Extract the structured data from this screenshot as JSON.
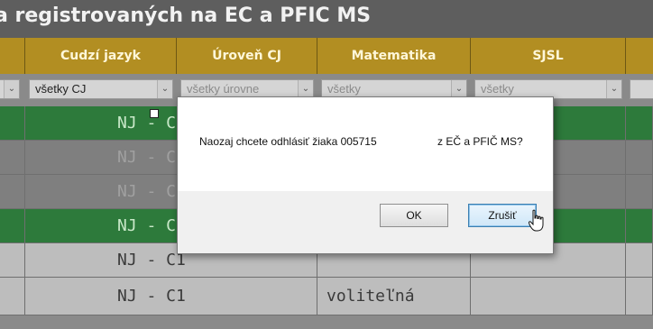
{
  "title": {
    "text": "a registrovaných na EC a PFIC MS"
  },
  "columns": [
    {
      "label": "Cudzí jazyk"
    },
    {
      "label": "Úroveň CJ"
    },
    {
      "label": "Matematika"
    },
    {
      "label": "SJSL"
    }
  ],
  "filters": {
    "cudzi_jazyk": "všetky CJ",
    "uroven": "všetky úrovne",
    "matematika": "všetky",
    "sjsl": "všetky"
  },
  "rows": [
    {
      "cj": "NJ - C1",
      "matematika": ""
    },
    {
      "cj": "NJ - C1",
      "matematika": ""
    },
    {
      "cj": "NJ - C1",
      "matematika": ""
    },
    {
      "cj": "NJ - C1",
      "matematika": ""
    },
    {
      "cj": "NJ - C1",
      "matematika": ""
    },
    {
      "cj": "NJ - C1",
      "matematika": "voliteľná"
    }
  ],
  "dialog": {
    "message": "Naozaj chcete odhlásiť žiaka 005715",
    "message_suffix": "z EČ a PFIČ MS?",
    "ok_label": "OK",
    "cancel_label": "Zrušiť"
  },
  "colors": {
    "header_gold": "#b28e22",
    "row_green": "#2d7a3b",
    "title_bg": "#5e5e5e"
  }
}
